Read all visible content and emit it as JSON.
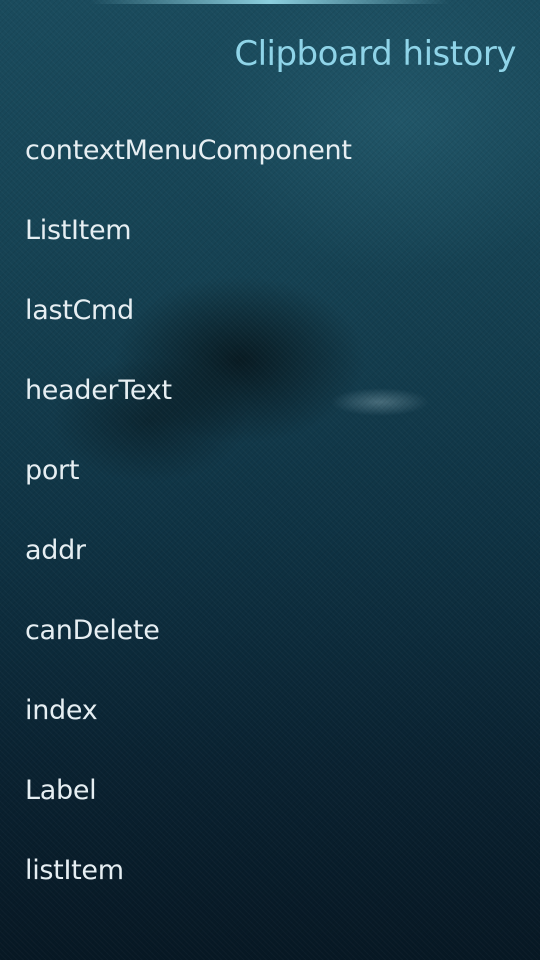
{
  "header": {
    "title": "Clipboard history"
  },
  "history": {
    "items": [
      {
        "label": "contextMenuComponent"
      },
      {
        "label": "ListItem"
      },
      {
        "label": "lastCmd"
      },
      {
        "label": "headerText"
      },
      {
        "label": "port"
      },
      {
        "label": "addr"
      },
      {
        "label": "canDelete"
      },
      {
        "label": "index"
      },
      {
        "label": "Label"
      },
      {
        "label": "listItem"
      }
    ]
  },
  "colors": {
    "title": "#8fd4e8",
    "item_text": "#e6eef2",
    "background_top": "#1a4b5d",
    "background_bottom": "#071824"
  }
}
